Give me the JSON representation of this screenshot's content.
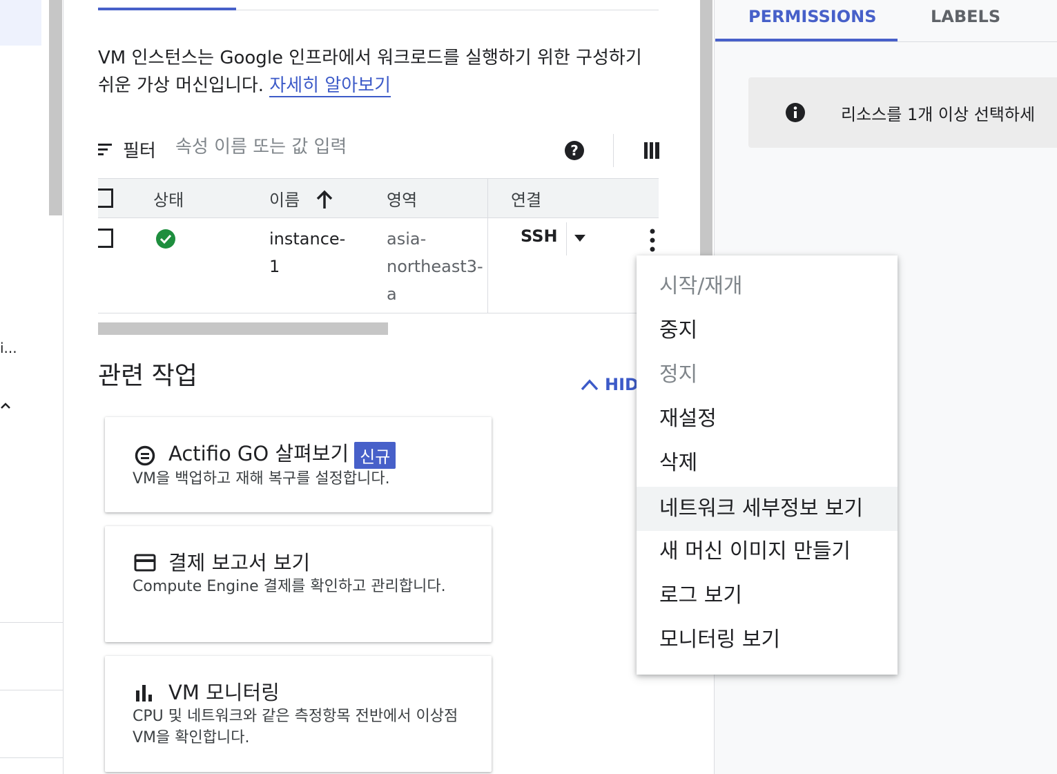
{
  "left": {
    "truncated_text": "i..."
  },
  "main": {
    "description": "VM 인스턴스는 Google 인프라에서 워크로드를 실행하기 위한 구성하기 쉬운 가상 머신입니다.",
    "learn_more": "자세히 알아보기",
    "filter": {
      "label": "필터",
      "placeholder": "속성 이름 또는 값 입력"
    },
    "table": {
      "headers": {
        "status": "상태",
        "name": "이름",
        "zone": "영역",
        "connect": "연결"
      },
      "row": {
        "name_line1": "instance-",
        "name_line2": "1",
        "zone_line1": "asia-",
        "zone_line2": "northeast3-",
        "zone_line3": "a",
        "connect": "SSH"
      }
    },
    "related": {
      "title": "관련 작업",
      "hide": "HID",
      "cards": [
        {
          "title": "Actifio GO 살펴보기",
          "badge": "신규",
          "desc": "VM을 백업하고 재해 복구를 설정합니다."
        },
        {
          "title": "결제 보고서 보기",
          "desc": "Compute Engine 결제를 확인하고 관리합니다."
        },
        {
          "title": "VM 모니터링",
          "desc": "CPU 및 네트워크와 같은 측정항목 전반에서 이상점 VM을 확인합니다."
        }
      ]
    }
  },
  "right": {
    "tabs": [
      "PERMISSIONS",
      "LABELS"
    ],
    "info": "리소스를 1개 이상 선택하세"
  },
  "menu": {
    "items": [
      {
        "label": "시작/재개",
        "disabled": true
      },
      {
        "label": "중지"
      },
      {
        "label": "정지",
        "disabled": true
      },
      {
        "label": "재설정"
      },
      {
        "label": "삭제"
      },
      {
        "label": "네트워크 세부정보 보기",
        "highlighted": true
      },
      {
        "label": "새 머신 이미지 만들기"
      },
      {
        "label": "로그 보기"
      },
      {
        "label": "모니터링 보기"
      }
    ]
  },
  "colors": {
    "accent": "#4760c9",
    "link": "#3c5ac8",
    "success": "#1e8e3e"
  }
}
